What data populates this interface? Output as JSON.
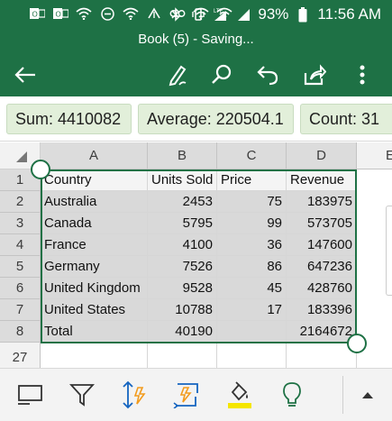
{
  "status_bar": {
    "battery": "93%",
    "time": "11:56 AM",
    "icons": [
      "outlook-icon",
      "outlook-icon",
      "wifi-icon",
      "do-not-disturb-icon",
      "wifi-icon",
      "network-icon",
      "voicemail-icon",
      "wifi-icon",
      "wifi-icon",
      "bluetooth-icon",
      "vibrate-icon",
      "lte-signal-icon",
      "signal-icon",
      "battery-icon"
    ]
  },
  "title_bar": {
    "title": "Book (5) - Saving..."
  },
  "toolbar": {
    "buttons": [
      "back-arrow-icon",
      "draw-pen-icon",
      "search-icon",
      "undo-icon",
      "share-icon",
      "more-vertical-icon"
    ]
  },
  "summary": {
    "sum": "Sum: 4410082",
    "average": "Average: 220504.1",
    "count": "Count: 31"
  },
  "sheet": {
    "columns": [
      "A",
      "B",
      "C",
      "D",
      "E"
    ],
    "rows": [
      "1",
      "2",
      "3",
      "4",
      "5",
      "6",
      "7",
      "8",
      "27"
    ],
    "header": [
      "Country",
      "Units Sold",
      "Price",
      "Revenue"
    ],
    "data": [
      [
        "Australia",
        "2453",
        "75",
        "183975"
      ],
      [
        "Canada",
        "5795",
        "99",
        "573705"
      ],
      [
        "France",
        "4100",
        "36",
        "147600"
      ],
      [
        "Germany",
        "7526",
        "86",
        "647236"
      ],
      [
        "United Kingdom",
        "9528",
        "45",
        "428760"
      ],
      [
        "United States",
        "10788",
        "17",
        "183396"
      ],
      [
        "Total",
        "40190",
        "",
        "2164672"
      ]
    ]
  },
  "accent_colors": {
    "excel_green": "#1e7145",
    "summary_chip": "#e2efda",
    "fill_yellow": "#f5e600",
    "lightning_orange": "#f29b1d"
  },
  "bottom_toolbar": {
    "buttons": [
      "new-sheet-icon",
      "filter-icon",
      "sort-icon",
      "fill-data-icon",
      "fill-color-icon",
      "ideas-lightbulb-icon",
      "expand-up-icon"
    ]
  }
}
